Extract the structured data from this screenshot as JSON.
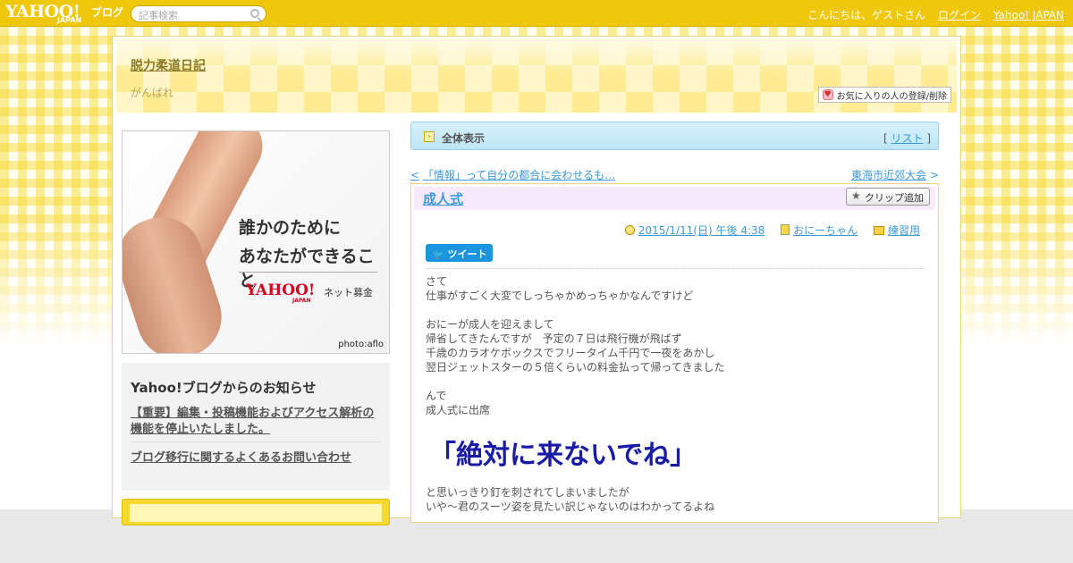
{
  "topbar": {
    "logo_text": "YAHOO!",
    "logo_sub": "JAPAN",
    "logo_service": "ブログ",
    "search_placeholder": "記事検索",
    "greeting": "こんにちは、ゲストさん",
    "login_label": "ログイン",
    "yahoo_japan_label": "Yahoo! JAPAN"
  },
  "blog": {
    "title": "脱力柔道日記",
    "subtitle": "がんばれ",
    "favorite_button": "お気に入りの人の登録/削除"
  },
  "ad": {
    "line1": "誰かのために",
    "line2": "あなたができること",
    "brand": "YAHOO!",
    "brand_sub": "JAPAN",
    "service": "ネット募金",
    "credit": "photo:aflo"
  },
  "notice": {
    "title": "Yahoo!ブログからのお知らせ",
    "items": [
      "【重要】編集・投稿機能およびアクセス解析の機能を停止いたしました。",
      "ブログ移行に関するよくあるお問い合わせ"
    ]
  },
  "view_bar": {
    "label": "全体表示",
    "list_label": "リスト",
    "bracket_open": "[",
    "bracket_close": "]"
  },
  "nav": {
    "prev_arrow": "<",
    "prev": "「情報」って自分の都合に会わせるも…",
    "next": "東海市近郊大会",
    "next_arrow": ">"
  },
  "article": {
    "title": "成人式",
    "clip_button": "クリップ追加",
    "date": "2015/1/11(日) 午後 4:38",
    "author": "おにーちゃん",
    "category": "練習用",
    "tweet_label": "ツイート",
    "body_lines": [
      "さて",
      "仕事がすごく大変でしっちゃかめっちゃかなんですけど",
      "",
      "おにーが成人を迎えまして",
      "帰省してきたんですが　予定の７日は飛行機が飛ばず",
      "千歳のカラオケボックスでフリータイム千円で一夜をあかし",
      "翌日ジェットスターの５倍くらいの料金払って帰ってきました",
      "",
      "んで",
      "成人式に出席"
    ],
    "highlight": "「絶対に来ないでね」",
    "body_lines2": [
      "と思いっきり釘を刺されてしまいましたが",
      "いや～君のスーツ姿を見たい訳じゃないのはわかってるよね"
    ]
  },
  "colors": {
    "topbar": "#efc80c",
    "link": "#3c9ad6",
    "highlight": "#1a1aa8",
    "title": "#8a7a2a"
  }
}
